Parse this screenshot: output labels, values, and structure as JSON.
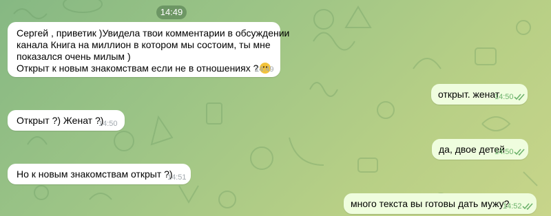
{
  "chat": {
    "date_separator": "14:49",
    "messages": [
      {
        "direction": "incoming",
        "lines": [
          "Сергей , приветик )Увидела твои комментарии в обсуждении",
          "канала Книга на миллион в котором мы состоим, ты мне",
          "показался очень милым )",
          "Открыт к новым знакомствам если не в отношениях ?"
        ],
        "emoji": "hugging-face",
        "time": "14:49"
      },
      {
        "direction": "outgoing",
        "text": "открыт. женат",
        "time": "14:50",
        "status": "read"
      },
      {
        "direction": "incoming",
        "text": "Открыт ?) Женат ?)",
        "time": "14:50"
      },
      {
        "direction": "outgoing",
        "text": "да, двое детей",
        "time": "14:50",
        "status": "read"
      },
      {
        "direction": "incoming",
        "text": "Но к новым знакомствам открыт ?)",
        "time": "14:51"
      },
      {
        "direction": "outgoing",
        "text": "много текста вы готовы дать мужу?",
        "time": "14:52",
        "status": "read"
      }
    ]
  },
  "colors": {
    "incoming_bubble": "#ffffff",
    "outgoing_bubble": "#effdde",
    "outgoing_meta": "#6cb26b",
    "incoming_meta": "#a0a7ad"
  }
}
